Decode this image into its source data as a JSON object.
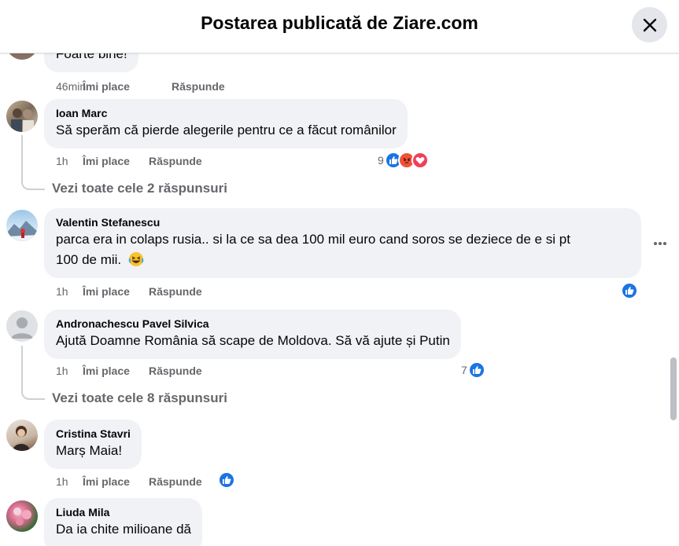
{
  "header": {
    "title": "Postarea publicată de Ziare.com",
    "close_icon": "close-icon"
  },
  "colors": {
    "bubble": "#f0f2f5",
    "secondary_text": "#65676b",
    "like_blue": "#1b74e4",
    "angry": "#f15238",
    "love": "#f33e58"
  },
  "actions_labels": {
    "like": "Îmi place",
    "reply": "Răspunde"
  },
  "comments": [
    {
      "text": "Foarte bine!",
      "time": "46min"
    },
    {
      "author": "Ioan Marc",
      "text": "Să sperăm că pierde alegerile pentru ce a făcut românilor",
      "time": "1h",
      "reaction_count": "9",
      "reactions": [
        "like-icon",
        "angry-icon",
        "love-icon"
      ],
      "view_replies": "Vezi toate cele 2 răspunsuri"
    },
    {
      "author": "Valentin Stefanescu",
      "text_line1": "parca era in colaps rusia.. si la ce sa dea 100 mil euro cand soros se deziece de e si pt",
      "text_line2": "100 de mii.",
      "emoji": "laughing-emoji",
      "time": "1h",
      "reactions": [
        "like-icon"
      ]
    },
    {
      "author": "Andronachescu Pavel Silvica",
      "text": "Ajută Doamne România să scape de Moldova. Să vă ajute și Putin",
      "time": "1h",
      "reaction_count": "7",
      "reactions": [
        "like-icon"
      ],
      "view_replies": "Vezi toate cele 8 răspunsuri"
    },
    {
      "author": "Cristina Stavri",
      "text": "Marș Maia!",
      "time": "1h",
      "reactions": [
        "like-icon"
      ]
    },
    {
      "author": "Liuda Mila",
      "text": "Da ia chite milioane dă"
    }
  ]
}
